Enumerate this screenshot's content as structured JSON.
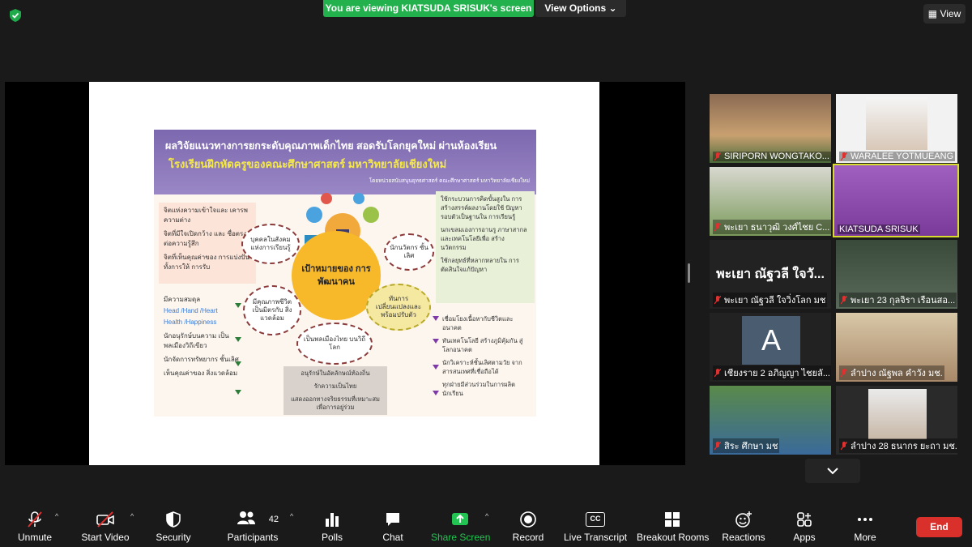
{
  "top": {
    "banner": "You are viewing KIATSUDA SRISUK's screen",
    "view_options": "View Options",
    "view_button": "View"
  },
  "slide": {
    "title": "ผลวิจัยแนวทางการยกระดับคุณภาพเด็กไทย สอดรับโลกยุคใหม่ ผ่านห้องเรียน",
    "subtitle": "โรงเรียนฝึกหัดครูของคณะศึกษาศาสตร์ มหาวิทยาลัยเชียงใหม่",
    "note": "โดยหน่วยสนับสนุนยุทธศาสตร์ คณะศึกษาศาสตร์ มหาวิทยาลัยเชียงใหม่",
    "center": "เป้าหมายของ การพัฒนาคน",
    "left_top": [
      "จิตแห่งความเข้าใจและ เคารพความต่าง",
      "จิตที่มีใจเปิดกว้าง และ ซื่อตรงต่อความรู้สึก",
      "จิตที่เห็นคุณค่าของ การแบ่งปันทั้งการให้ การรับ"
    ],
    "left_mid": {
      "heading": "มีความสมดุล",
      "hhhh_1": "Head /Hand /Heart",
      "hhhh_2": "Health /Happiness",
      "items": [
        "นักอนุรักษ์บนความ เป็นพลเมืองวิถีเขียว",
        "นักจัดการทรัพยากร ชั้นเลิศ",
        "เห็นคุณค่าของ สิ่งแวดล้อม"
      ]
    },
    "right_top": [
      "ใช้กระบวนการคิดขั้นสูงใน การสร้างสรรค์ผลงานโดยใช้ ปัญหารอบตัวเป็นฐานใน การเรียนรู้",
      "นกเขลมเองการอานรู ภาษาสากล และเทคโนโลยีเพื่อ สร้างนวัตกรรม",
      "ใช้กลยุทธ์ที่หลากหลายใน การตัดสินใจแก้ปัญหา"
    ],
    "right_bottom": [
      "เชื่อมโยงเนื้อหากับชีวิตและ อนาคต",
      "ทันเทคโนโลยี สร้างภูมิคุ้มกัน สู่โลกอนาคต",
      "นักวิเคราะห์ชั้นเลิศตามวัย จากสารสนเทศที่เชื่อถือได้",
      "ทุกฝ่ายมีส่วนร่วมในการผลิต นักเรียน"
    ],
    "bubbles": [
      "บุคคลในสังคม แห่งการเรียนรู้",
      "นักนวัตกร ชั้นเลิศ",
      "มีคุณภาพชีวิต เป็นมิตรกับ สิ่งแวดล้อม",
      "ทันการ เปลี่ยนแปลงและ พร้อมปรับตัว",
      "เป็นพลเมืองไทย บนวิถีโลก"
    ],
    "bottom_box": [
      "อนุรักษ์ในอัตลักษณ์ท้องถิ่น",
      "รักความเป็นไทย",
      "แสดงออกทางจริยธรรมที่เหมาะสมเพื่อการอยู่ร่วม"
    ]
  },
  "gallery": [
    {
      "name": "SIRIPORN WONGTAKO...",
      "muted": true
    },
    {
      "name": "WARALEE YOTMUEANG",
      "muted": true
    },
    {
      "name": "พะเยา ธนาวุฒิ วงศ์ไชย C...",
      "muted": true
    },
    {
      "name": "KIATSUDA SRISUK",
      "muted": false,
      "active": true
    },
    {
      "name": "พะเยา ณัฐวลี ใจวิ่งโลก มช",
      "muted": true,
      "big": "พะเยา ณัฐวลี ใจวั..."
    },
    {
      "name": "พะเยา 23 กุลจิรา เรือนสอ...",
      "muted": true
    },
    {
      "name": "เชียงราย 2 อภิญญา ไชยลั...",
      "muted": true,
      "avatar": "A"
    },
    {
      "name": "ลำปาง ณัฐพล คำวัง มช.",
      "muted": true
    },
    {
      "name": "สิระ ศึกษา มช",
      "muted": true
    },
    {
      "name": "ลำปาง 28 ธนากร ยะถา มช.",
      "muted": true
    }
  ],
  "toolbar": {
    "unmute": "Unmute",
    "start_video": "Start Video",
    "security": "Security",
    "participants": "Participants",
    "participants_count": "42",
    "polls": "Polls",
    "chat": "Chat",
    "share_screen": "Share Screen",
    "record": "Record",
    "live_transcript": "Live Transcript",
    "cc": "CC",
    "breakout_rooms": "Breakout Rooms",
    "reactions": "Reactions",
    "apps": "Apps",
    "more": "More",
    "end": "End"
  },
  "colors": {
    "banner_green": "#22b14c",
    "end_red": "#d9302c",
    "active_border": "#d8dc2f",
    "share_green": "#23c552"
  }
}
